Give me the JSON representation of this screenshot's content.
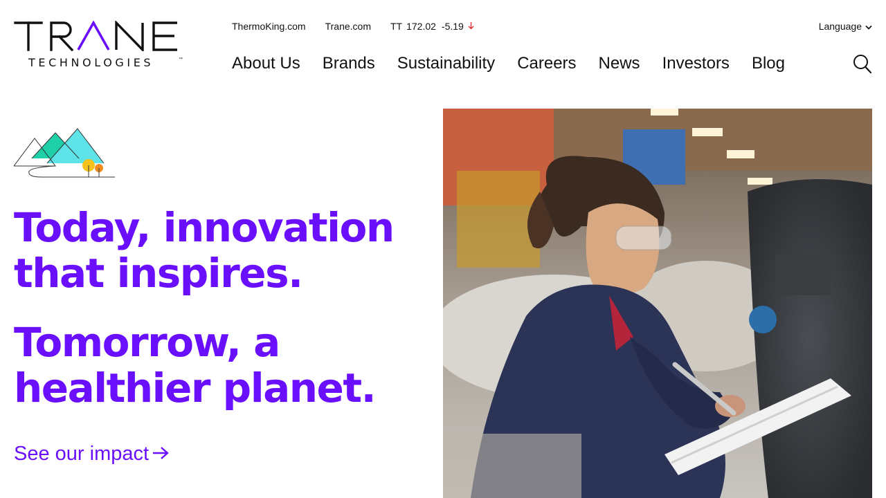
{
  "logo": {
    "wordmark": "TRANE",
    "subline": "TECHNOLOGIES",
    "tm": "™",
    "colors": {
      "primary": "#111111",
      "accent": "#6a0ffb"
    }
  },
  "utility": {
    "links": [
      "ThermoKing.com",
      "Trane.com"
    ],
    "ticker": {
      "symbol": "TT",
      "price": "172.02",
      "change": "-5.19",
      "direction": "down",
      "direction_color": "#e0262b"
    },
    "language_label": "Language"
  },
  "nav": {
    "items": [
      "About Us",
      "Brands",
      "Sustainability",
      "Careers",
      "News",
      "Investors",
      "Blog"
    ],
    "search_icon": "search-icon"
  },
  "hero": {
    "illustration_icon": "mountains-illustration",
    "headline_1": "Today, innovation that inspires.",
    "headline_2": "Tomorrow, a healthier planet.",
    "cta_label": "See our impact",
    "cta_icon": "arrow-right-icon",
    "image_subject": "technician-writing-on-clipboard-photo",
    "accent_color": "#6a0ffb"
  }
}
